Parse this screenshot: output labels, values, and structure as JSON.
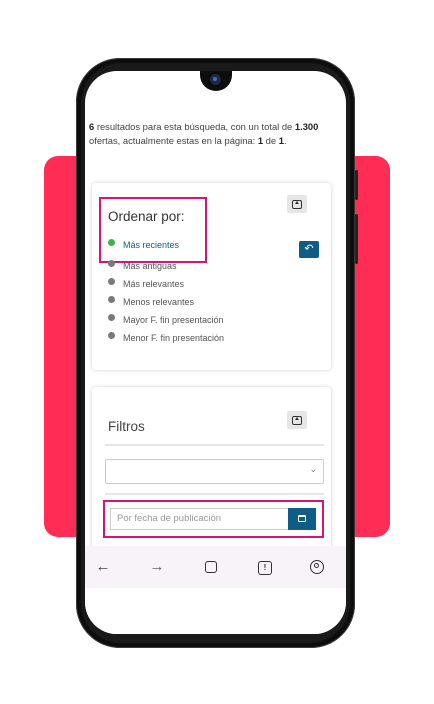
{
  "colors": {
    "backdrop": "#ff2d55",
    "accent": "#0f5c86",
    "highlight": "#d6127b",
    "active_dot": "#3fb24a"
  },
  "results": {
    "count": "6",
    "text1": " resultados para esta búsqueda, con un total de ",
    "total": "1.300",
    "text2": " ofertas, actualmente estas en la página: ",
    "page": "1",
    "text3": " de ",
    "pages": "1",
    "text4": "."
  },
  "order": {
    "title": "Ordenar por:",
    "collapse_icon": "collapse-up-icon",
    "back_icon": "undo-arrow-icon",
    "back_glyph": "↶",
    "options": [
      {
        "label": "Más recientes",
        "active": true
      },
      {
        "label": "Más antiguas",
        "active": false
      },
      {
        "label": "Más relevantes",
        "active": false
      },
      {
        "label": "Menos relevantes",
        "active": false
      },
      {
        "label": "Mayor F. fin presentación",
        "active": false
      },
      {
        "label": "Menor F. fin presentación",
        "active": false
      }
    ]
  },
  "filters": {
    "title": "Filtros",
    "select_value": "",
    "select_chevron": "⌄",
    "date_placeholder": "Por fecha de publicación",
    "calendar_icon": "calendar-icon"
  },
  "navbar": {
    "back": "←",
    "forward": "→",
    "icons": [
      "back-arrow-icon",
      "forward-arrow-icon",
      "home-icon",
      "info-icon",
      "account-icon"
    ]
  }
}
